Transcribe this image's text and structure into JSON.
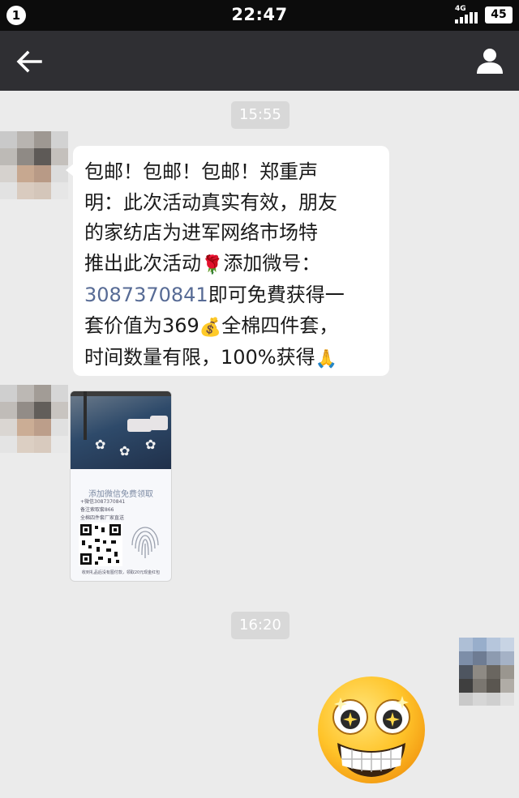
{
  "status_bar": {
    "notification_count": "1",
    "time": "22:47",
    "network": "4G",
    "battery": "45"
  },
  "header": {
    "back_icon": "back-arrow-icon",
    "title": "",
    "profile_icon": "person-icon"
  },
  "messages": [
    {
      "type": "timestamp",
      "text": "15:55"
    },
    {
      "type": "text",
      "side": "left",
      "lines": {
        "l1": "包邮！包邮！包邮！郑重声",
        "l2": "明：此次活动真实有效，朋友",
        "l3": "的家纺店为进军网络市场特",
        "l4a": "推出此次活动",
        "l4b": "添加微号：",
        "l5_phone": "3087370841",
        "l5b": "即可免費获得一",
        "l6a": "套价值为369",
        "l6b": "全棉四件套，",
        "l7": "时间数量有限，100%获得"
      },
      "emojis": {
        "rose": "🌹",
        "money_bag": "💰",
        "pray": "🙏"
      }
    },
    {
      "type": "image",
      "side": "left",
      "card": {
        "title": "添加微信免费领取",
        "row1": "+微信3087370841",
        "row2": "备注索取套866",
        "row3": "全棉四件套厂家直送",
        "footer": "收到礼品后没有图付款，领取20元现金红包"
      }
    },
    {
      "type": "timestamp",
      "text": "16:20"
    },
    {
      "type": "sticker",
      "side": "right",
      "icon": "starry-eyed-grin-icon"
    }
  ],
  "colors": {
    "chat_background": "#ebebeb",
    "header": "#2f2f33",
    "status_bar": "#0c0c0c",
    "bubble": "#ffffff",
    "link": "#576b95",
    "timestamp_chip": "#d8d8d8"
  }
}
